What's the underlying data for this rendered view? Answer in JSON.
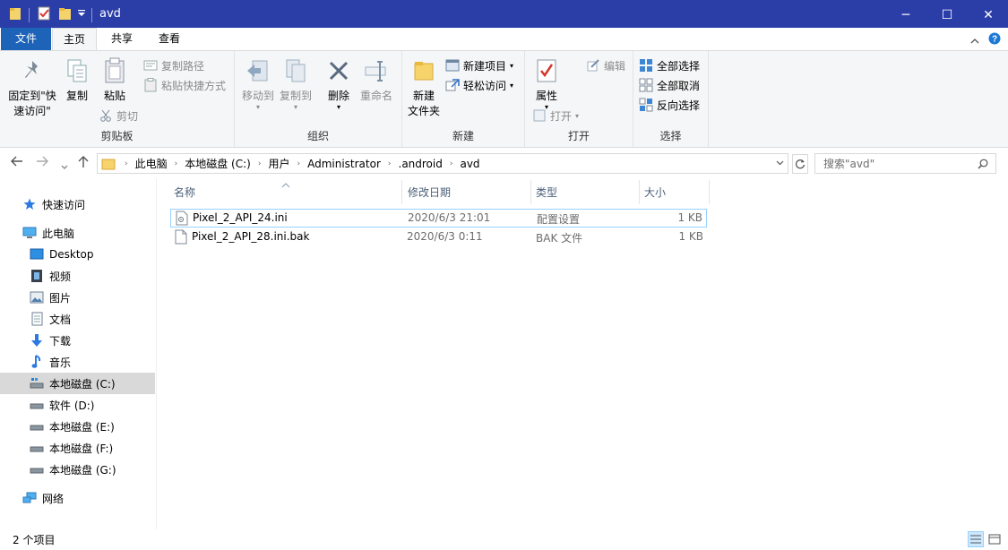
{
  "window": {
    "title": "avd",
    "minimize_glyph": "─",
    "maximize_glyph": "☐",
    "close_glyph": "✕"
  },
  "ribbon_tabs": {
    "file": "文件",
    "home": "主页",
    "share": "共享",
    "view": "查看"
  },
  "ribbon": {
    "clipboard": {
      "label": "剪贴板",
      "pin": "固定到\"快",
      "pin2": "速访问\"",
      "copy": "复制",
      "paste": "粘贴",
      "copy_path": "复制路径",
      "paste_shortcut": "粘贴快捷方式",
      "cut": "剪切"
    },
    "organize": {
      "label": "组织",
      "move_to": "移动到",
      "copy_to": "复制到",
      "delete": "删除",
      "rename": "重命名"
    },
    "new": {
      "label": "新建",
      "new_folder": "新建",
      "new_folder2": "文件夹",
      "new_item": "新建项目",
      "easy_access": "轻松访问"
    },
    "open": {
      "label": "打开",
      "properties": "属性",
      "open": "打开",
      "edit": "编辑"
    },
    "select": {
      "label": "选择",
      "select_all": "全部选择",
      "select_none": "全部取消",
      "invert": "反向选择"
    }
  },
  "address": {
    "crumbs": [
      "此电脑",
      "本地磁盘 (C:)",
      "用户",
      "Administrator",
      ".android",
      "avd"
    ],
    "search_placeholder": "搜索\"avd\""
  },
  "nav": {
    "quick_access": "快速访问",
    "this_pc": "此电脑",
    "items": [
      "Desktop",
      "视频",
      "图片",
      "文档",
      "下载",
      "音乐",
      "本地磁盘 (C:)",
      "软件 (D:)",
      "本地磁盘 (E:)",
      "本地磁盘 (F:)",
      "本地磁盘 (G:)"
    ],
    "network": "网络"
  },
  "columns": {
    "name": "名称",
    "date": "修改日期",
    "type": "类型",
    "size": "大小"
  },
  "files": [
    {
      "name": "Pixel_2_API_24.ini",
      "date": "2020/6/3 21:01",
      "type": "配置设置",
      "size": "1 KB"
    },
    {
      "name": "Pixel_2_API_28.ini.bak",
      "date": "2020/6/3 0:11",
      "type": "BAK 文件",
      "size": "1 KB"
    }
  ],
  "status": {
    "count": "2 个项目"
  },
  "colors": {
    "title_bar": "#2b3ea8",
    "file_tab": "#1d63b8",
    "selection_border": "#99d1ff",
    "nav_selected": "#d9d9d9"
  }
}
